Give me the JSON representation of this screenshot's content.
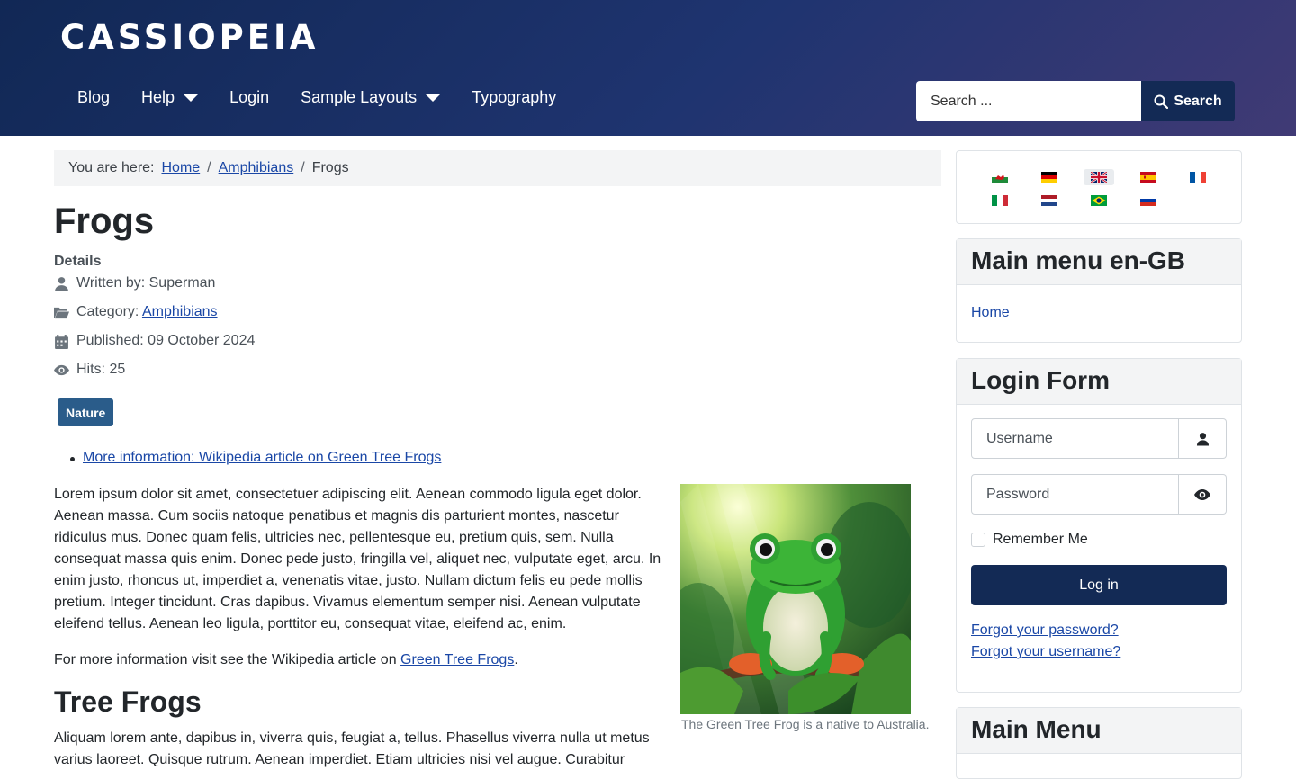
{
  "site": {
    "brand": "CASSIOPEIA"
  },
  "nav": {
    "items": [
      {
        "label": "Blog",
        "dropdown": false
      },
      {
        "label": "Help",
        "dropdown": true
      },
      {
        "label": "Login",
        "dropdown": false
      },
      {
        "label": "Sample Layouts",
        "dropdown": true
      },
      {
        "label": "Typography",
        "dropdown": false
      }
    ]
  },
  "search": {
    "placeholder": "Search ...",
    "button_label": "Search"
  },
  "breadcrumb": {
    "prefix": "You are here:",
    "items": [
      "Home",
      "Amphibians",
      "Frogs"
    ]
  },
  "article": {
    "title": "Frogs",
    "details_label": "Details",
    "written_by": "Written by: Superman",
    "category_prefix": "Category: ",
    "category": "Amphibians",
    "published": "Published: 09 October 2024",
    "hits": "Hits: 25",
    "tag": "Nature",
    "link": "More information: Wikipedia article on Green Tree Frogs",
    "paragraph1": "Lorem ipsum dolor sit amet, consectetuer adipiscing elit. Aenean commodo ligula eget dolor. Aenean massa. Cum sociis natoque penatibus et magnis dis parturient montes, nascetur ridiculus mus. Donec quam felis, ultricies nec, pellentesque eu, pretium quis, sem. Nulla consequat massa quis enim. Donec pede justo, fringilla vel, aliquet nec, vulputate eget, arcu. In enim justo, rhoncus ut, imperdiet a, venenatis vitae, justo. Nullam dictum felis eu pede mollis pretium. Integer tincidunt. Cras dapibus. Vivamus elementum semper nisi. Aenean vulputate eleifend tellus. Aenean leo ligula, porttitor eu, consequat vitae, eleifend ac, enim.",
    "para2_prefix": "For more information visit see the Wikipedia article on ",
    "para2_link": "Green Tree Frogs",
    "para2_suffix": ".",
    "subheading": "Tree Frogs",
    "paragraph3": "Aliquam lorem ante, dapibus in, viverra quis, feugiat a, tellus. Phasellus viverra nulla ut metus varius laoreet. Quisque rutrum. Aenean imperdiet. Etiam ultricies nisi vel augue. Curabitur",
    "image_caption": "The Green Tree Frog is a native to Australia."
  },
  "languages": [
    "cy-GB",
    "de-DE",
    "en-GB",
    "es-ES",
    "fr-FR",
    "it-IT",
    "nl-NL",
    "pt-BR",
    "ru-RU"
  ],
  "main_menu_engb": {
    "title": "Main menu en-GB",
    "items": [
      "Home"
    ]
  },
  "login_form": {
    "title": "Login Form",
    "username_placeholder": "Username",
    "password_placeholder": "Password",
    "remember_label": "Remember Me",
    "login_button": "Log in",
    "forgot_password": "Forgot your password?",
    "forgot_username": "Forgot your username?"
  },
  "main_menu": {
    "title": "Main Menu"
  }
}
